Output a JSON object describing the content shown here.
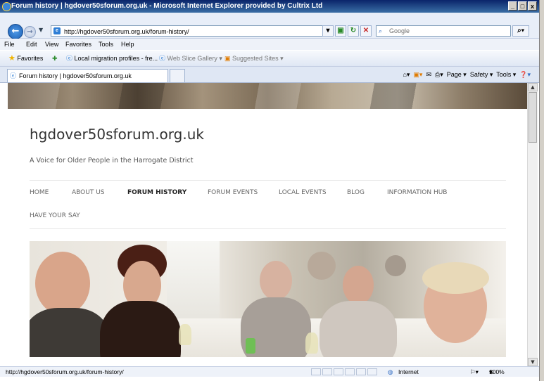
{
  "window": {
    "title": "Forum history | hgdover50sforum.org.uk - Microsoft Internet Explorer provided by Cultrix Ltd",
    "minimize": "_",
    "maximize": "□",
    "close": "x"
  },
  "address_bar": {
    "url": "http://hgdover50sforum.org.uk/forum-history/",
    "search_placeholder": "Google"
  },
  "menu": [
    "File",
    "Edit",
    "View",
    "Favorites",
    "Tools",
    "Help"
  ],
  "favorites_bar": {
    "favorites_label": "Favorites",
    "items": [
      "Local migration profiles - fre...",
      "Web Slice Gallery ▾",
      "Suggested Sites ▾"
    ]
  },
  "tab": {
    "title": "Forum history | hgdover50sforum.org.uk"
  },
  "command_bar": {
    "page": "Page ▾",
    "safety": "Safety ▾",
    "tools": "Tools ▾"
  },
  "site": {
    "title": "hgdover50sforum.org.uk",
    "tagline": "A Voice for Older People in the Harrogate District",
    "nav": [
      "HOME",
      "ABOUT US",
      "FORUM HISTORY",
      "FORUM EVENTS",
      "LOCAL EVENTS",
      "BLOG",
      "INFORMATION HUB",
      "HAVE YOUR SAY"
    ],
    "active_nav": "FORUM HISTORY"
  },
  "status_bar": {
    "url": "http://hgdover50sforum.org.uk/forum-history/",
    "zone": "Internet",
    "zoom": "100%"
  },
  "colors": {
    "title_bar": "#0a246a",
    "chrome": "#e8eef8"
  }
}
